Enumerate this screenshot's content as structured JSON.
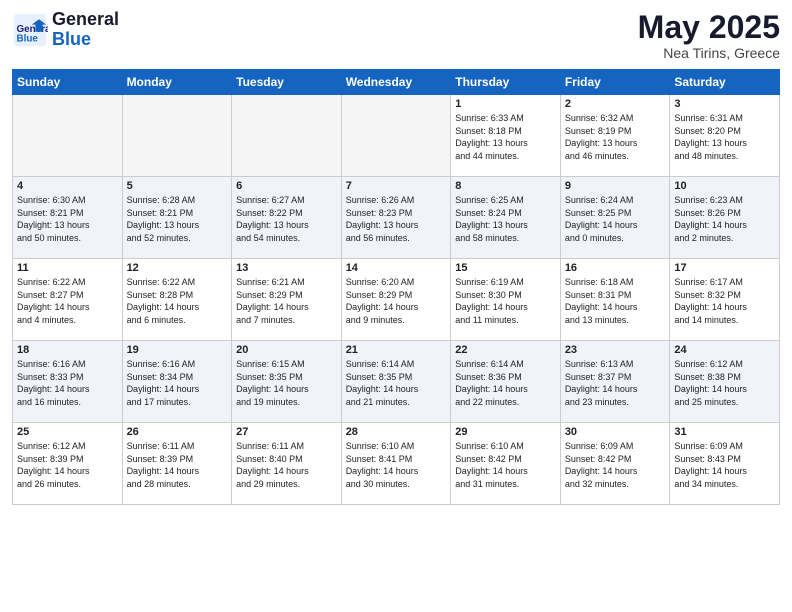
{
  "header": {
    "logo_general": "General",
    "logo_blue": "Blue",
    "title": "May 2025",
    "subtitle": "Nea Tirins, Greece"
  },
  "weekdays": [
    "Sunday",
    "Monday",
    "Tuesday",
    "Wednesday",
    "Thursday",
    "Friday",
    "Saturday"
  ],
  "weeks": [
    [
      {
        "day": "",
        "info": ""
      },
      {
        "day": "",
        "info": ""
      },
      {
        "day": "",
        "info": ""
      },
      {
        "day": "",
        "info": ""
      },
      {
        "day": "1",
        "info": "Sunrise: 6:33 AM\nSunset: 8:18 PM\nDaylight: 13 hours\nand 44 minutes."
      },
      {
        "day": "2",
        "info": "Sunrise: 6:32 AM\nSunset: 8:19 PM\nDaylight: 13 hours\nand 46 minutes."
      },
      {
        "day": "3",
        "info": "Sunrise: 6:31 AM\nSunset: 8:20 PM\nDaylight: 13 hours\nand 48 minutes."
      }
    ],
    [
      {
        "day": "4",
        "info": "Sunrise: 6:30 AM\nSunset: 8:21 PM\nDaylight: 13 hours\nand 50 minutes."
      },
      {
        "day": "5",
        "info": "Sunrise: 6:28 AM\nSunset: 8:21 PM\nDaylight: 13 hours\nand 52 minutes."
      },
      {
        "day": "6",
        "info": "Sunrise: 6:27 AM\nSunset: 8:22 PM\nDaylight: 13 hours\nand 54 minutes."
      },
      {
        "day": "7",
        "info": "Sunrise: 6:26 AM\nSunset: 8:23 PM\nDaylight: 13 hours\nand 56 minutes."
      },
      {
        "day": "8",
        "info": "Sunrise: 6:25 AM\nSunset: 8:24 PM\nDaylight: 13 hours\nand 58 minutes."
      },
      {
        "day": "9",
        "info": "Sunrise: 6:24 AM\nSunset: 8:25 PM\nDaylight: 14 hours\nand 0 minutes."
      },
      {
        "day": "10",
        "info": "Sunrise: 6:23 AM\nSunset: 8:26 PM\nDaylight: 14 hours\nand 2 minutes."
      }
    ],
    [
      {
        "day": "11",
        "info": "Sunrise: 6:22 AM\nSunset: 8:27 PM\nDaylight: 14 hours\nand 4 minutes."
      },
      {
        "day": "12",
        "info": "Sunrise: 6:22 AM\nSunset: 8:28 PM\nDaylight: 14 hours\nand 6 minutes."
      },
      {
        "day": "13",
        "info": "Sunrise: 6:21 AM\nSunset: 8:29 PM\nDaylight: 14 hours\nand 7 minutes."
      },
      {
        "day": "14",
        "info": "Sunrise: 6:20 AM\nSunset: 8:29 PM\nDaylight: 14 hours\nand 9 minutes."
      },
      {
        "day": "15",
        "info": "Sunrise: 6:19 AM\nSunset: 8:30 PM\nDaylight: 14 hours\nand 11 minutes."
      },
      {
        "day": "16",
        "info": "Sunrise: 6:18 AM\nSunset: 8:31 PM\nDaylight: 14 hours\nand 13 minutes."
      },
      {
        "day": "17",
        "info": "Sunrise: 6:17 AM\nSunset: 8:32 PM\nDaylight: 14 hours\nand 14 minutes."
      }
    ],
    [
      {
        "day": "18",
        "info": "Sunrise: 6:16 AM\nSunset: 8:33 PM\nDaylight: 14 hours\nand 16 minutes."
      },
      {
        "day": "19",
        "info": "Sunrise: 6:16 AM\nSunset: 8:34 PM\nDaylight: 14 hours\nand 17 minutes."
      },
      {
        "day": "20",
        "info": "Sunrise: 6:15 AM\nSunset: 8:35 PM\nDaylight: 14 hours\nand 19 minutes."
      },
      {
        "day": "21",
        "info": "Sunrise: 6:14 AM\nSunset: 8:35 PM\nDaylight: 14 hours\nand 21 minutes."
      },
      {
        "day": "22",
        "info": "Sunrise: 6:14 AM\nSunset: 8:36 PM\nDaylight: 14 hours\nand 22 minutes."
      },
      {
        "day": "23",
        "info": "Sunrise: 6:13 AM\nSunset: 8:37 PM\nDaylight: 14 hours\nand 23 minutes."
      },
      {
        "day": "24",
        "info": "Sunrise: 6:12 AM\nSunset: 8:38 PM\nDaylight: 14 hours\nand 25 minutes."
      }
    ],
    [
      {
        "day": "25",
        "info": "Sunrise: 6:12 AM\nSunset: 8:39 PM\nDaylight: 14 hours\nand 26 minutes."
      },
      {
        "day": "26",
        "info": "Sunrise: 6:11 AM\nSunset: 8:39 PM\nDaylight: 14 hours\nand 28 minutes."
      },
      {
        "day": "27",
        "info": "Sunrise: 6:11 AM\nSunset: 8:40 PM\nDaylight: 14 hours\nand 29 minutes."
      },
      {
        "day": "28",
        "info": "Sunrise: 6:10 AM\nSunset: 8:41 PM\nDaylight: 14 hours\nand 30 minutes."
      },
      {
        "day": "29",
        "info": "Sunrise: 6:10 AM\nSunset: 8:42 PM\nDaylight: 14 hours\nand 31 minutes."
      },
      {
        "day": "30",
        "info": "Sunrise: 6:09 AM\nSunset: 8:42 PM\nDaylight: 14 hours\nand 32 minutes."
      },
      {
        "day": "31",
        "info": "Sunrise: 6:09 AM\nSunset: 8:43 PM\nDaylight: 14 hours\nand 34 minutes."
      }
    ]
  ]
}
